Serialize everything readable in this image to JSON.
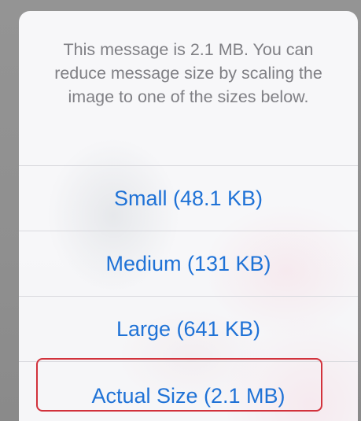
{
  "dialog": {
    "message": "This message is 2.1 MB. You can reduce message size by scaling the image to one of the sizes below.",
    "options": [
      {
        "label": "Small (48.1 KB)"
      },
      {
        "label": "Medium (131 KB)"
      },
      {
        "label": "Large (641 KB)"
      },
      {
        "label": "Actual Size (2.1 MB)"
      }
    ]
  },
  "colors": {
    "action_text": "#1f72d6",
    "message_text": "#7f7f84",
    "highlight": "#d2323c"
  }
}
